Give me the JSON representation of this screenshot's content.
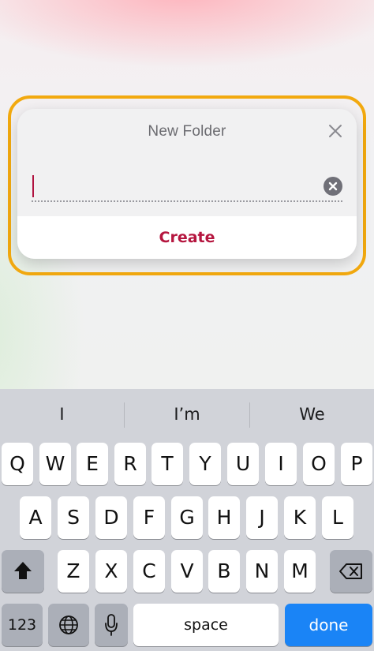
{
  "dialog": {
    "title": "New Folder",
    "input_value": "",
    "create_label": "Create"
  },
  "keyboard": {
    "suggestions": [
      "I",
      "I’m",
      "We"
    ],
    "row1": [
      "Q",
      "W",
      "E",
      "R",
      "T",
      "Y",
      "U",
      "I",
      "O",
      "P"
    ],
    "row2": [
      "A",
      "S",
      "D",
      "F",
      "G",
      "H",
      "J",
      "K",
      "L"
    ],
    "row3": [
      "Z",
      "X",
      "C",
      "V",
      "B",
      "N",
      "M"
    ],
    "numbers_label": "123",
    "space_label": "space",
    "done_label": "done"
  },
  "colors": {
    "accent": "#b5163f",
    "highlight": "#f2a90f",
    "done_key": "#1a84f6"
  },
  "icons": {
    "close": "close-icon",
    "clear": "clear-text-icon",
    "shift": "shift-icon",
    "backspace": "backspace-icon",
    "globe": "globe-icon",
    "microphone": "microphone-icon"
  }
}
